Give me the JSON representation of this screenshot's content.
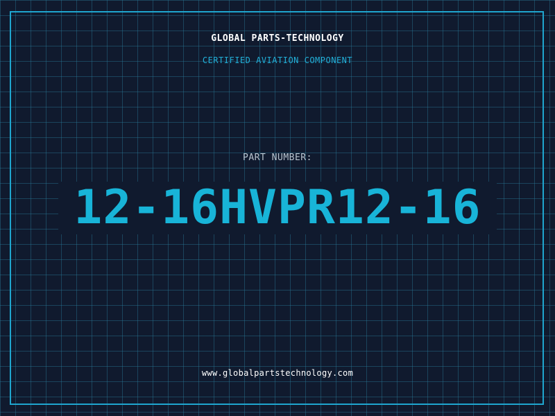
{
  "header": {
    "company": "GLOBAL PARTS-TECHNOLOGY",
    "subtitle": "CERTIFIED AVIATION COMPONENT"
  },
  "part": {
    "label": "PART NUMBER:",
    "number": "12-16HVPR12-16"
  },
  "footer": {
    "website": "www.globalpartstechnology.com"
  },
  "colors": {
    "background": "#101a2e",
    "grid": "#28789a",
    "frame": "#1fa6cf",
    "accent": "#18b4d8",
    "label": "#b9c4cf",
    "text": "#ffffff"
  }
}
